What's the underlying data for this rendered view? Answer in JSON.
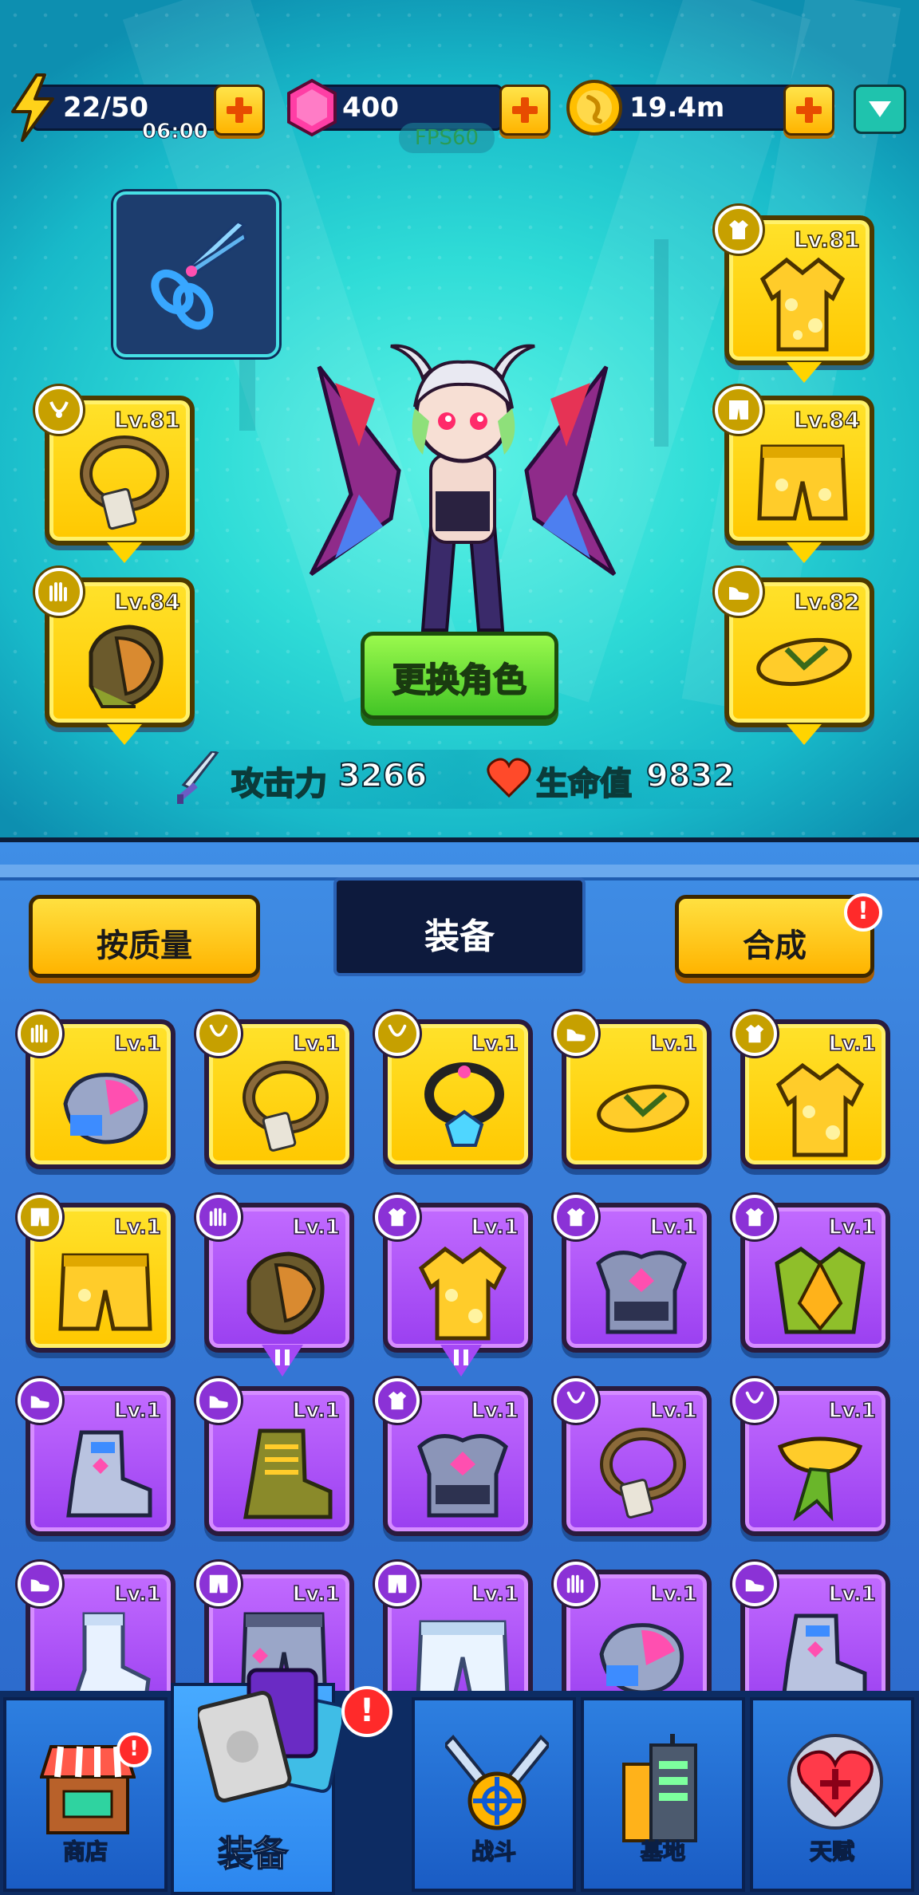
{
  "resources": {
    "energy": {
      "value": "22/50",
      "timer": "06:00",
      "icon": "lightning-icon"
    },
    "gems": {
      "value": "400",
      "icon": "pink-gem-icon"
    },
    "coins": {
      "value": "19.4m",
      "icon": "gold-coin-icon"
    }
  },
  "fps": "FPS60",
  "equipped": {
    "weapon": {
      "icon": "scissors-icon"
    },
    "necklace": {
      "level": "Lv.81",
      "slot_icon": "necklace-slot-icon"
    },
    "gloves": {
      "level": "Lv.84",
      "slot_icon": "glove-slot-icon"
    },
    "shirt": {
      "level": "Lv.81",
      "slot_icon": "shirt-slot-icon"
    },
    "shorts": {
      "level": "Lv.84",
      "slot_icon": "shorts-slot-icon"
    },
    "shoes": {
      "level": "Lv.82",
      "slot_icon": "shoe-slot-icon"
    }
  },
  "change_character": "更换角色",
  "stats": {
    "attack_label": "攻击力",
    "attack_value": "3266",
    "hp_label": "生命值",
    "hp_value": "9832"
  },
  "tabs": {
    "sort": "按质量",
    "equipment": "装备",
    "merge": "合成",
    "merge_alert": "!"
  },
  "inventory": [
    {
      "level": "Lv.1",
      "rarity": "gold",
      "item": "gloves-chrome"
    },
    {
      "level": "Lv.1",
      "rarity": "gold",
      "item": "necklace-tag"
    },
    {
      "level": "Lv.1",
      "rarity": "gold",
      "item": "necklace-gem"
    },
    {
      "level": "Lv.1",
      "rarity": "gold",
      "item": "sandals-yellow"
    },
    {
      "level": "Lv.1",
      "rarity": "gold",
      "item": "shirt-hawaiian"
    },
    {
      "level": "Lv.1",
      "rarity": "gold",
      "item": "shorts-yellow"
    },
    {
      "level": "Lv.1",
      "rarity": "purple",
      "item": "glove-orange",
      "paused": true
    },
    {
      "level": "Lv.1",
      "rarity": "purple",
      "item": "shirt-hawaiian",
      "paused": true
    },
    {
      "level": "Lv.1",
      "rarity": "purple",
      "item": "armor-chrome"
    },
    {
      "level": "Lv.1",
      "rarity": "purple",
      "item": "armor-green"
    },
    {
      "level": "Lv.1",
      "rarity": "purple",
      "item": "boots-chrome"
    },
    {
      "level": "Lv.1",
      "rarity": "purple",
      "item": "boots-combat"
    },
    {
      "level": "Lv.1",
      "rarity": "purple",
      "item": "armor-chrome"
    },
    {
      "level": "Lv.1",
      "rarity": "purple",
      "item": "necklace-tag"
    },
    {
      "level": "Lv.1",
      "rarity": "purple",
      "item": "scarf-yellow"
    },
    {
      "level": "Lv.1",
      "rarity": "purple",
      "item": "sock-white"
    },
    {
      "level": "Lv.1",
      "rarity": "purple",
      "item": "pants-chrome"
    },
    {
      "level": "Lv.1",
      "rarity": "purple",
      "item": "shorts-white"
    },
    {
      "level": "Lv.1",
      "rarity": "purple",
      "item": "gloves-chrome"
    },
    {
      "level": "Lv.1",
      "rarity": "purple",
      "item": "boots-chrome"
    }
  ],
  "nav": {
    "shop": "商店",
    "equipment": "装备",
    "battle": "战斗",
    "base": "基地",
    "talent": "天赋",
    "alert": "!"
  },
  "colors": {
    "gold_frame": "#ffc800",
    "purple_frame": "#9a3ff0",
    "accent_green": "#43c526",
    "alert_red": "#ff2a2a"
  }
}
